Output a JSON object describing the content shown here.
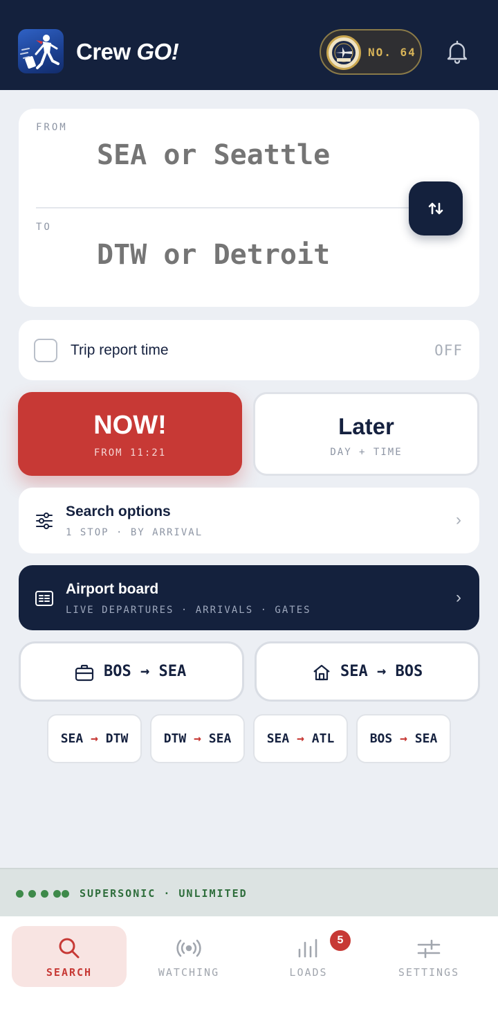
{
  "header": {
    "app_name": "Crew",
    "app_name_emphasis": "GO!",
    "badge_text": "NO. 64",
    "badge_medal_text": "FIRST 100"
  },
  "route": {
    "from_label": "FROM",
    "from_placeholder": "SEA or Seattle",
    "to_label": "TO",
    "to_placeholder": "DTW or Detroit",
    "swap_icon": "swap-vertical-icon"
  },
  "trip_report": {
    "label": "Trip report time",
    "state": "OFF"
  },
  "time_choice": {
    "now_label": "NOW!",
    "now_sub": "FROM 11:21",
    "later_label": "Later",
    "later_sub": "DAY + TIME"
  },
  "search_options": {
    "title": "Search options",
    "subtitle": "1 STOP · BY ARRIVAL",
    "chevron": "›"
  },
  "airport_board": {
    "title": "Airport board",
    "subtitle": "LIVE DEPARTURES · ARRIVALS · GATES",
    "chevron": "›"
  },
  "quick_routes": [
    {
      "icon": "briefcase-icon",
      "from": "BOS",
      "arrow": "→",
      "to": "SEA"
    },
    {
      "icon": "home-icon",
      "from": "SEA",
      "arrow": "→",
      "to": "BOS"
    }
  ],
  "recent_routes": [
    {
      "from": "SEA",
      "arrow": "→",
      "to": "DTW"
    },
    {
      "from": "DTW",
      "arrow": "→",
      "to": "SEA"
    },
    {
      "from": "SEA",
      "arrow": "→",
      "to": "ATL"
    },
    {
      "from": "BOS",
      "arrow": "→",
      "to": "SEA"
    }
  ],
  "status": {
    "text": "SUPERSONIC · UNLIMITED",
    "dots": 5,
    "color": "#3e8a4a"
  },
  "nav": {
    "items": [
      {
        "label": "SEARCH",
        "icon": "search-icon",
        "active": true
      },
      {
        "label": "WATCHING",
        "icon": "broadcast-icon",
        "active": false
      },
      {
        "label": "LOADS",
        "icon": "bar-loads-icon",
        "active": false
      },
      {
        "label": "SETTINGS",
        "icon": "sliders-icon",
        "active": false
      }
    ],
    "loads_count": "5"
  },
  "colors": {
    "navy": "#14213d",
    "accent_red": "#c73935",
    "background": "#eceff4"
  }
}
